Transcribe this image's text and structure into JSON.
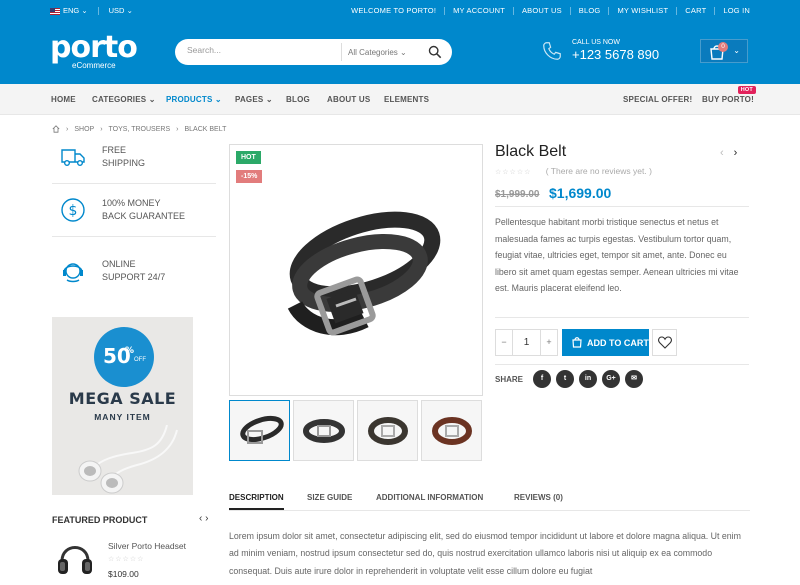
{
  "topbar": {
    "language": "ENG",
    "currency": "USD",
    "links": [
      "WELCOME TO PORTO!",
      "MY ACCOUNT",
      "ABOUT US",
      "BLOG",
      "MY WISHLIST",
      "CART",
      "LOG IN"
    ]
  },
  "header": {
    "logo_word": "porto",
    "logo_sub": "eCommerce",
    "search_placeholder": "Search...",
    "search_category": "All Categories",
    "call_label": "CALL US NOW",
    "phone": "+123 5678 890",
    "cart_count": "0"
  },
  "nav": {
    "items": [
      "HOME",
      "CATEGORIES",
      "PRODUCTS",
      "PAGES",
      "BLOG",
      "ABOUT US",
      "ELEMENTS"
    ],
    "right_items": [
      "SPECIAL OFFER!",
      "BUY PORTO!"
    ],
    "hot_label": "HOT"
  },
  "breadcrumb": [
    "SHOP",
    "TOYS, TROUSERS",
    "BLACK BELT"
  ],
  "features": [
    {
      "line1": "FREE",
      "line2": "SHIPPING",
      "icon": "truck-icon"
    },
    {
      "line1": "100% MONEY",
      "line2": "BACK GUARANTEE",
      "icon": "dollar-icon"
    },
    {
      "line1": "ONLINE",
      "line2": "SUPPORT 24/7",
      "icon": "headset-icon"
    }
  ],
  "banner": {
    "percent": "50",
    "percent_sign": "%",
    "off": "OFF",
    "title": "MEGA SALE",
    "subtitle": "MANY ITEM"
  },
  "featured": {
    "title": "FEATURED PRODUCT",
    "product_name": "Silver Porto Headset",
    "price": "$109.00"
  },
  "product": {
    "badge_hot": "HOT",
    "badge_sale": "-15%",
    "title": "Black Belt",
    "reviews": "( There are no reviews yet. )",
    "old_price": "$1,999.00",
    "price": "$1,699.00",
    "description": "Pellentesque habitant morbi tristique senectus et netus et malesuada fames ac turpis egestas. Vestibulum tortor quam, feugiat vitae, ultricies eget, tempor sit amet, ante. Donec eu libero sit amet quam egestas semper. Aenean ultricies mi vitae est. Mauris placerat eleifend leo.",
    "quantity": "1",
    "add_to_cart": "ADD TO CART",
    "share_label": "SHARE",
    "colors": {
      "accent": "#0088cc",
      "hot": "#2ba968",
      "sale": "#e27c7c"
    }
  },
  "tabs": {
    "items": [
      "DESCRIPTION",
      "SIZE GUIDE",
      "ADDITIONAL INFORMATION",
      "REVIEWS (0)"
    ],
    "content": "Lorem ipsum dolor sit amet, consectetur adipiscing elit, sed do eiusmod tempor incididunt ut labore et dolore magna aliqua. Ut enim ad minim veniam, nostrud ipsum consectetur sed do, quis nostrud exercitation ullamco laboris nisi ut aliquip ex ea commodo consequat. Duis aute irure dolor in reprehenderit in voluptate velit esse cillum dolore eu fugiat"
  }
}
